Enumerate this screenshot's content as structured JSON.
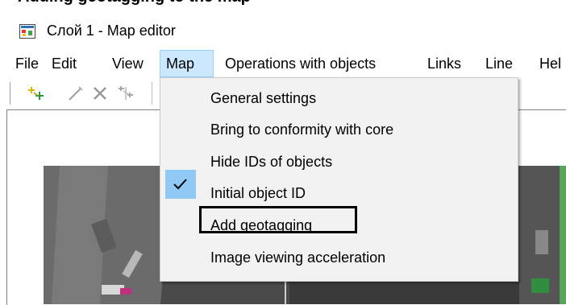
{
  "top_heading_partial": "Adding geotagging to the map",
  "window": {
    "title": "Слой 1 - Map editor"
  },
  "menubar": {
    "items": [
      "File",
      "Edit",
      "View",
      "Map",
      "Operations with objects",
      "Links",
      "Line",
      "Hel"
    ],
    "active": "Map"
  },
  "toolbar": {
    "icons": [
      "add-point-icon",
      "draw-line-icon",
      "delete-icon",
      "connect-points-icon"
    ]
  },
  "map_menu": {
    "items": [
      {
        "label": "General settings",
        "checked": false
      },
      {
        "label": "Bring to conformity with core",
        "checked": false
      },
      {
        "label": "Hide IDs of objects",
        "checked": false
      },
      {
        "label": "Initial object ID",
        "checked": true
      },
      {
        "label": "Add geotagging",
        "checked": false,
        "highlighted": true
      },
      {
        "label": "Image viewing acceleration",
        "checked": false
      }
    ]
  },
  "colors": {
    "menu_active_bg": "#cce8ff",
    "menu_active_border": "#99d1ff",
    "dropdown_bg": "#f2f2f2",
    "check_bg": "#90c8f6"
  }
}
